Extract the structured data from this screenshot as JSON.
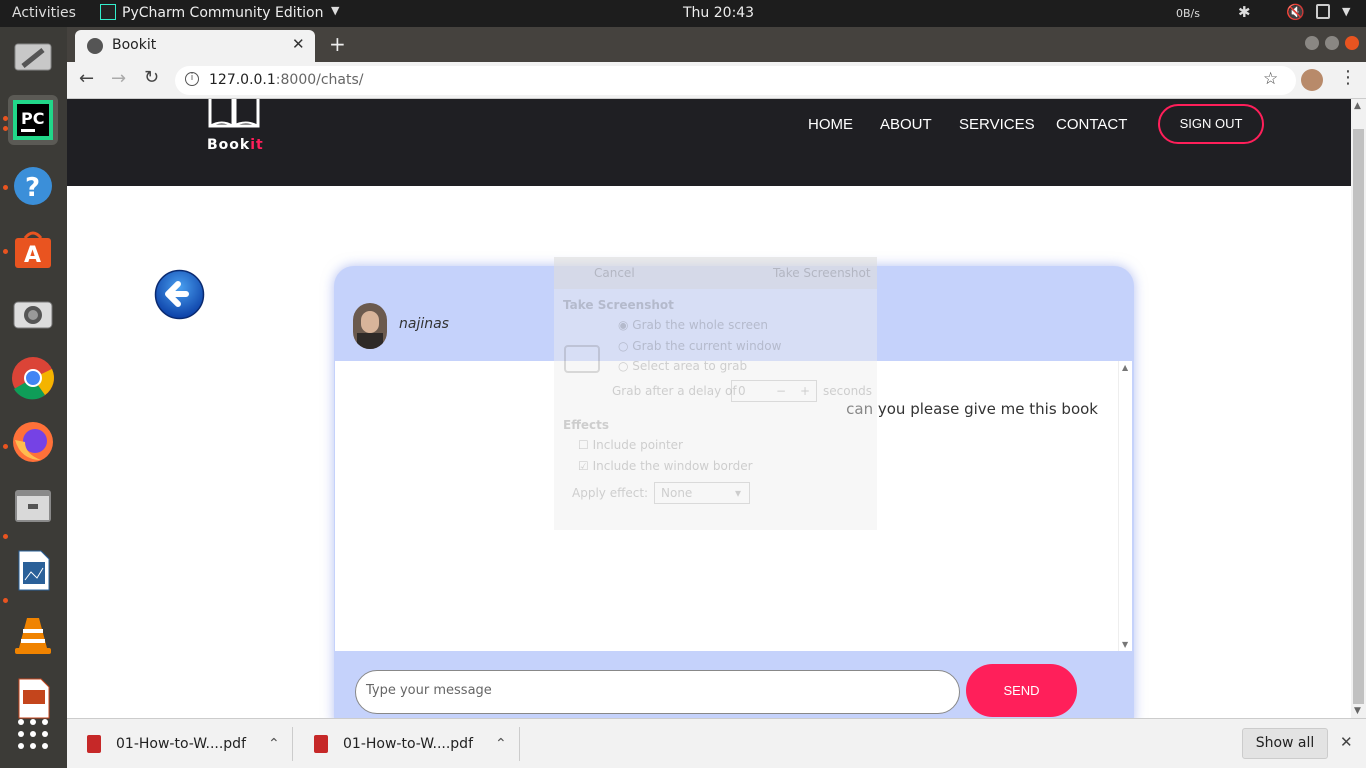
{
  "topbar": {
    "activities": "Activities",
    "app_name": "PyCharm Community Edition",
    "clock": "Thu 20:43",
    "net_speed": "0B/s"
  },
  "dock": {
    "items": [
      "system-settings-icon",
      "pycharm-icon",
      "help-icon",
      "software-center-icon",
      "screenshot-icon",
      "chrome-icon",
      "firefox-icon",
      "files-icon",
      "libreoffice-writer-icon",
      "vlc-icon",
      "libreoffice-impress-icon",
      "show-apps-icon"
    ]
  },
  "browser": {
    "tab_title": "Bookit",
    "url_host": "127.0.0.1",
    "url_rest": ":8000/chats/"
  },
  "site": {
    "logo_part1": "Book",
    "logo_part2": "it",
    "nav": {
      "home": "HOME",
      "about": "ABOUT",
      "services": "SERVICES",
      "contact": "CONTACT"
    },
    "signout": "SIGN OUT",
    "accent": "#ff1f5a"
  },
  "chat": {
    "username": "najinas",
    "messages": [
      {
        "text": "can you please give me this book"
      }
    ],
    "input_placeholder": "Type your message",
    "send_label": "SEND"
  },
  "screenshot_dialog": {
    "cancel": "Cancel",
    "take_button": "Take Screenshot",
    "section_title": "Take Screenshot",
    "options": [
      "Grab the whole screen",
      "Grab the current window",
      "Select area to grab"
    ],
    "delay_label": "Grab after a delay of",
    "delay_value": "0",
    "delay_unit": "seconds",
    "effects_title": "Effects",
    "include_pointer": "Include pointer",
    "include_border": "Include the window border",
    "apply_effect_label": "Apply effect:",
    "apply_effect_value": "None"
  },
  "downloads": {
    "items": [
      "01-How-to-W....pdf",
      "01-How-to-W....pdf"
    ],
    "show_all": "Show all"
  }
}
